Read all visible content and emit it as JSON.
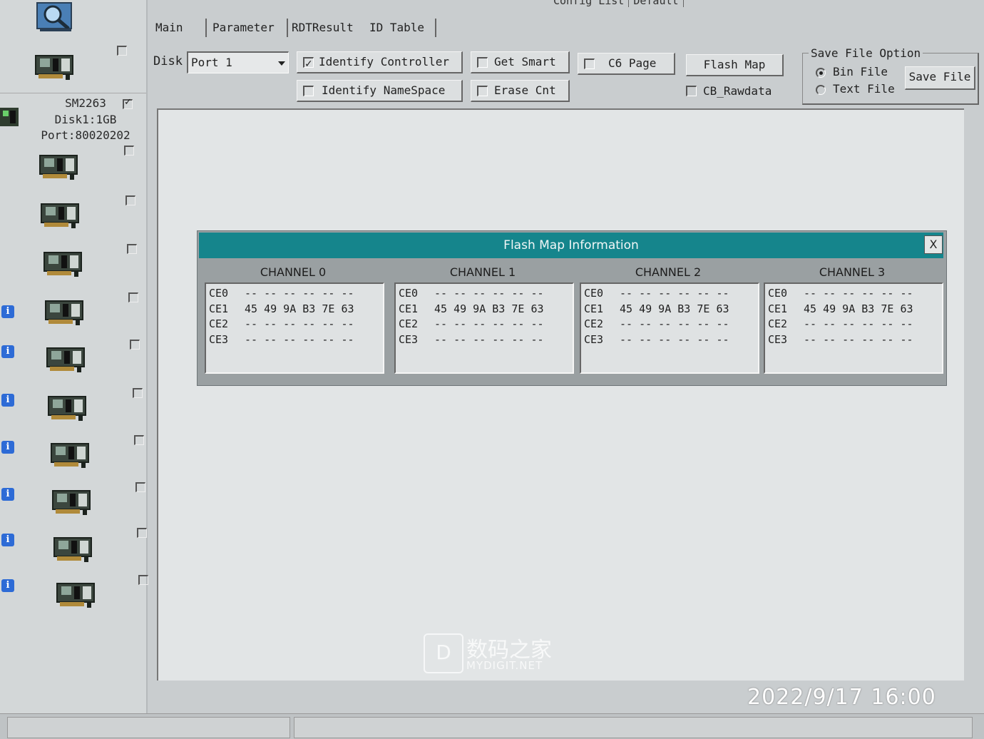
{
  "top_tabs": [
    "Config List",
    "Default"
  ],
  "main_tabs": [
    "Main",
    "Parameter",
    "RDTResult",
    "ID Table"
  ],
  "toolbar": {
    "disk_label": "Disk",
    "disk_value": "Port 1",
    "identify_controller": "Identify Controller",
    "identify_controller_checked": true,
    "get_smart": "Get Smart",
    "c6_page": "C6 Page",
    "flash_map": "Flash Map",
    "identify_namespace": "Identify NameSpace",
    "erase_cnt": "Erase Cnt",
    "cb_rawdata": "CB_Rawdata"
  },
  "save_option": {
    "legend": "Save File Option",
    "bin_file": "Bin File",
    "text_file": "Text File",
    "selected": "Bin File",
    "save_button": "Save File"
  },
  "device": {
    "model": "SM2263",
    "disk": "Disk1:1GB",
    "port": "Port:80020202",
    "checked": true
  },
  "flash_map": {
    "title": "Flash Map Information",
    "close": "X",
    "channels": [
      {
        "name": "CHANNEL 0",
        "rows": [
          {
            "ce": "CE0",
            "ids": "-- -- -- -- -- --"
          },
          {
            "ce": "CE1",
            "ids": "45 49 9A B3 7E 63"
          },
          {
            "ce": "CE2",
            "ids": "-- -- -- -- -- --"
          },
          {
            "ce": "CE3",
            "ids": "-- -- -- -- -- --"
          }
        ]
      },
      {
        "name": "CHANNEL 1",
        "rows": [
          {
            "ce": "CE0",
            "ids": "-- -- -- -- -- --"
          },
          {
            "ce": "CE1",
            "ids": "45 49 9A B3 7E 63"
          },
          {
            "ce": "CE2",
            "ids": "-- -- -- -- -- --"
          },
          {
            "ce": "CE3",
            "ids": "-- -- -- -- -- --"
          }
        ]
      },
      {
        "name": "CHANNEL 2",
        "rows": [
          {
            "ce": "CE0",
            "ids": "-- -- -- -- -- --"
          },
          {
            "ce": "CE1",
            "ids": "45 49 9A B3 7E 63"
          },
          {
            "ce": "CE2",
            "ids": "-- -- -- -- -- --"
          },
          {
            "ce": "CE3",
            "ids": "-- -- -- -- -- --"
          }
        ]
      },
      {
        "name": "CHANNEL 3",
        "rows": [
          {
            "ce": "CE0",
            "ids": "-- -- -- -- -- --"
          },
          {
            "ce": "CE1",
            "ids": "45 49 9A B3 7E 63"
          },
          {
            "ce": "CE2",
            "ids": "-- -- -- -- -- --"
          },
          {
            "ce": "CE3",
            "ids": "-- -- -- -- -- --"
          }
        ]
      }
    ]
  },
  "watermark": {
    "icon": "D",
    "text": "数码之家",
    "site": "MYDIGIT.NET"
  },
  "timestamp": "2022/9/17  16:00",
  "colors": {
    "title_bar": "#15858c",
    "info_icon": "#2d6bd6"
  },
  "icons": {
    "scan": "magnifier-scan-icon",
    "device": "pcie-card-icon",
    "info": "info-icon"
  }
}
